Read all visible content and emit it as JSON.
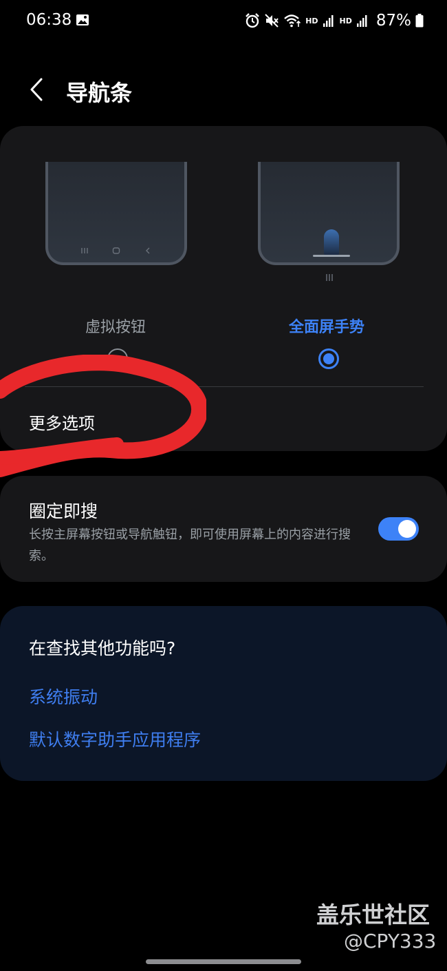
{
  "status_bar": {
    "time": "06:38",
    "hd_1": "HD",
    "hd_2": "HD",
    "battery": "87%",
    "icons": [
      "gallery-icon",
      "alarm-icon",
      "mute-icon",
      "wifi-icon",
      "signal-icon",
      "signal-icon",
      "battery-icon"
    ]
  },
  "header": {
    "title": "导航条",
    "back_icon": "chevron-left-icon"
  },
  "navigation_type": {
    "options": [
      {
        "label": "虚拟按钮",
        "selected": false
      },
      {
        "label": "全面屏手势",
        "selected": true
      }
    ],
    "more_options": "更多选项"
  },
  "circle_to_search": {
    "title": "圈定即搜",
    "description": "长按主屏幕按钮或导航触钮，即可使用屏幕上的内容进行搜索。",
    "enabled": true
  },
  "looking_for": {
    "title": "在查找其他功能吗?",
    "links": [
      "系统振动",
      "默认数字助手应用程序"
    ]
  },
  "watermark": {
    "site": "盖乐世社区",
    "handle": "@CPY333"
  },
  "colors": {
    "accent": "#3d82f7",
    "card": "#171719",
    "card_blue": "#0c1628",
    "annotation": "#e8282b"
  }
}
